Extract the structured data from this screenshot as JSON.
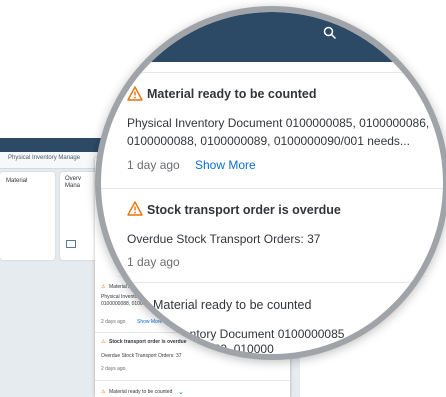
{
  "background": {
    "tab_label": "Physical Inventory Manage",
    "tile1_title": "Material",
    "tile2_title_line1": "Overv",
    "tile2_title_line2": "Mana"
  },
  "notifications_small": [
    {
      "title": "Material rea",
      "lines": [
        "Physical Inventory",
        "0100000088, 01000001"
      ],
      "time": "2 days ago",
      "action": "Show More"
    },
    {
      "title": "Stock transport order is overdue",
      "lines": [
        "Overdue Stock Transport Orders: 37"
      ],
      "time": "2 days ago"
    },
    {
      "title": "Material ready to be counted"
    }
  ],
  "notifications_zoomed": [
    {
      "title": "Material ready to be counted",
      "body_line1": "Physical Inventory Document 0100000085, 0100000086,",
      "body_line2": "0100000088, 0100000089, 0100000090/001 needs...",
      "time": "1 day ago",
      "action": "Show More"
    },
    {
      "title": "Stock transport order is overdue",
      "body_line1": "Overdue Stock Transport Orders: 37",
      "time": "1 day ago"
    }
  ],
  "overlap_text": {
    "title": "Material ready to be counted",
    "line1": "ventory Document 0100000085",
    "line2": "000089, 010000"
  },
  "colors": {
    "shell": "#2c4a66",
    "warning": "#e9730c",
    "link": "#0a6ed1"
  },
  "icons": {
    "search": "search-icon",
    "warning": "warning-icon",
    "expand": "chevron-down-icon"
  }
}
